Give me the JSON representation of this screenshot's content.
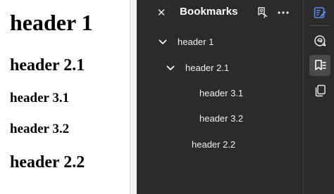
{
  "document": {
    "headings": {
      "h1": "header 1",
      "h2_1": "header 2.1",
      "h3_1": "header 3.1",
      "h3_2": "header 3.2",
      "h2_2": "header 2.2"
    }
  },
  "panel": {
    "title": "Bookmarks",
    "close_icon": "close-icon",
    "add_bookmark_icon": "add-bookmark-icon",
    "more_icon": "more-options-icon",
    "bookmarks": [
      {
        "label": "header 1",
        "expanded": true
      },
      {
        "label": "header 2.1",
        "expanded": true
      },
      {
        "label": "header 3.1"
      },
      {
        "label": "header 3.2"
      },
      {
        "label": "header 2.2"
      }
    ]
  },
  "rail": {
    "tools": [
      "edit-pdf-icon",
      "comment-icon",
      "bookmarks-icon",
      "pages-icon"
    ],
    "active_tool": "bookmarks-icon"
  },
  "colors": {
    "panel_bg": "#2b2b2b",
    "active_tool_bg": "#4a4a4a",
    "accent_blue": "#5b8def"
  }
}
